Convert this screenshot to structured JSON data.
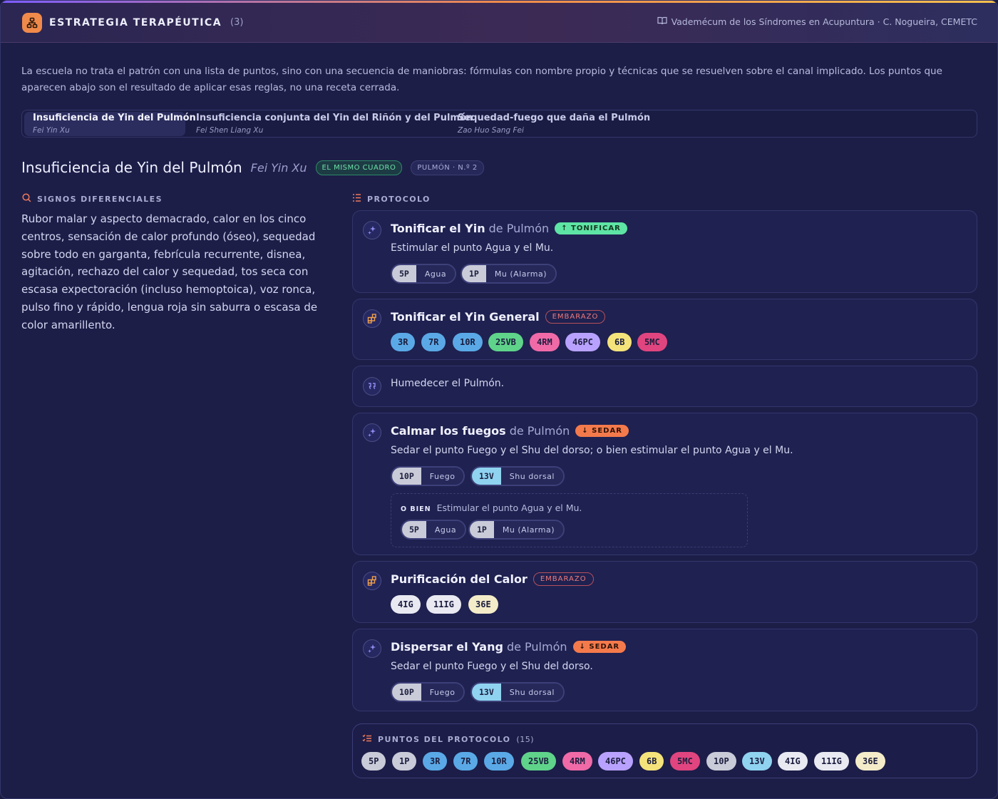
{
  "header": {
    "title": "ESTRATEGIA TERAPÉUTICA",
    "count": "(3)",
    "source": "Vademécum de los Síndromes en Acupuntura · C. Nogueira, CEMETC"
  },
  "intro": "La escuela no trata el patrón con una lista de puntos, sino con una secuencia de maniobras: fórmulas con nombre propio y técnicas que se resuelven sobre el canal implicado. Los puntos que aparecen abajo son el resultado de aplicar esas reglas, no una receta cerrada.",
  "tabs": [
    {
      "label": "Insuficiencia de Yin del Pulmón",
      "pinyin": "Fei Yin Xu"
    },
    {
      "label": "Insuficiencia conjunta del Yin del Riñón y del Pulmón",
      "pinyin": "Fei Shen Liang Xu"
    },
    {
      "label": "Sequedad-fuego que daña el Pulmón",
      "pinyin": "Zao Huo Sang Fei"
    }
  ],
  "section": {
    "title": "Insuficiencia de Yin del Pulmón",
    "pinyin": "Fei Yin Xu",
    "badge1": "EL MISMO CUADRO",
    "badge2": "PULMÓN · N.º 2"
  },
  "signs": {
    "label": "SIGNOS DIFERENCIALES",
    "text": "Rubor malar y aspecto demacrado, calor en los cinco centros, sensación de calor profundo (óseo), sequedad sobre todo en garganta, febrícula recurrente, disnea, agitación, rechazo del calor y sequedad, tos seca con escasa expectoración (incluso hemoptoica), voz ronca, pulso fino y rápido, lengua roja sin saburra o escasa de color amarillento."
  },
  "protocol": {
    "label": "PROTOCOLO",
    "steps": [
      {
        "bold": "Tonificar el Yin",
        "rest": "de Pulmón",
        "tag": "↑ TONIFICAR",
        "desc": "Estimular el punto Agua y el Mu.",
        "points": [
          {
            "code": "5P",
            "name": "Agua"
          },
          {
            "code": "1P",
            "name": "Mu (Alarma)"
          }
        ]
      },
      {
        "bold": "Tonificar el Yin General",
        "tag": "EMBARAZO",
        "chips": [
          "3R",
          "7R",
          "10R",
          "25VB",
          "4RM",
          "46PC",
          "6B",
          "5MC"
        ]
      },
      {
        "desc": "Humedecer el Pulmón."
      },
      {
        "bold": "Calmar los fuegos",
        "rest": "de Pulmón",
        "tag": "↓ SEDAR",
        "desc": "Sedar el punto Fuego y el Shu del dorso; o bien estimular el punto Agua y el Mu.",
        "points": [
          {
            "code": "10P",
            "name": "Fuego"
          },
          {
            "code": "13V",
            "name": "Shu dorsal"
          }
        ],
        "alt": {
          "label": "O BIEN",
          "text": "Estimular el punto Agua y el Mu.",
          "points": [
            {
              "code": "5P",
              "name": "Agua"
            },
            {
              "code": "1P",
              "name": "Mu (Alarma)"
            }
          ]
        }
      },
      {
        "bold": "Purificación del Calor",
        "tag": "EMBARAZO",
        "chips": [
          "4IG",
          "11IG",
          "36E"
        ]
      },
      {
        "bold": "Dispersar el Yang",
        "rest": "de Pulmón",
        "tag": "↓ SEDAR",
        "desc": "Sedar el punto Fuego y el Shu del dorso.",
        "points": [
          {
            "code": "10P",
            "name": "Fuego"
          },
          {
            "code": "13V",
            "name": "Shu dorsal"
          }
        ]
      }
    ]
  },
  "summary": {
    "label": "PUNTOS DEL PROTOCOLO",
    "count": "(15)",
    "chips": [
      "5P",
      "1P",
      "3R",
      "7R",
      "10R",
      "25VB",
      "4RM",
      "46PC",
      "6B",
      "5MC",
      "10P",
      "13V",
      "4IG",
      "11IG",
      "36E"
    ]
  },
  "colors": {
    "metal": "#c9cbd8",
    "water": "#5aa9e6",
    "wood": "#5fd38a",
    "fire": "#f06aa8",
    "pericardium": "#b9a2ff",
    "earth": "#f4e37a",
    "heart": "#e0457f",
    "bladder": "#8fd3f0",
    "colon": "#e9e9f2",
    "stomach": "#f4ecc9",
    "accent": "#f08a4b"
  },
  "icons": [
    "network-icon",
    "book-icon",
    "search-icon",
    "list-icon",
    "sparkle-icon",
    "grid-icon",
    "quote-icon",
    "checklist-icon"
  ]
}
